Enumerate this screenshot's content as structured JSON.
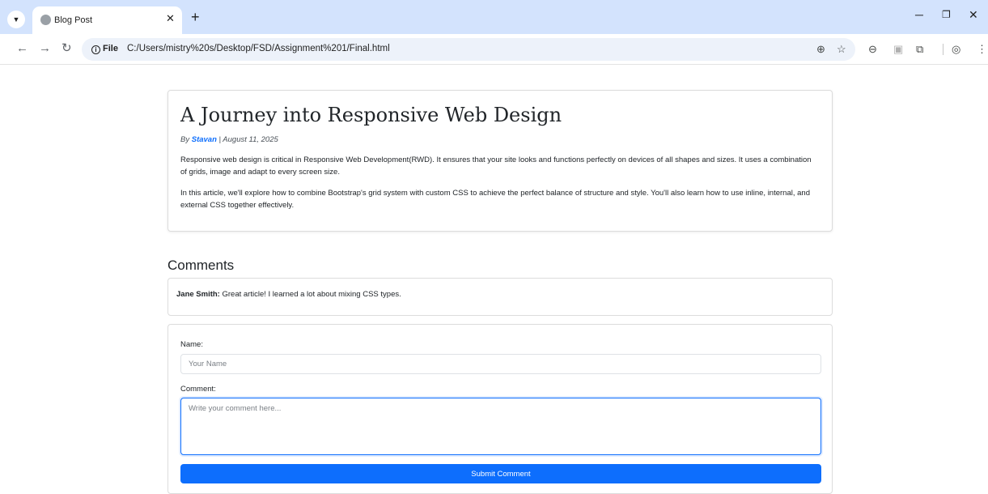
{
  "browser": {
    "tab_title": "Blog Post",
    "site_info_label": "File",
    "url": "C:/Users/mistry%20s/Desktop/FSD/Assignment%201/Final.html",
    "icons": {
      "tab_menu": "chevron-down-icon",
      "tab_close": "close-icon",
      "new_tab": "plus-icon",
      "back": "back-arrow-icon",
      "forward": "forward-arrow-icon",
      "reload": "reload-icon",
      "zoom": "zoom-icon",
      "bookmark": "star-icon",
      "extension_a": "extension-icon",
      "extension_b": "extension-icon",
      "extensions_menu": "puzzle-icon",
      "profile": "profile-icon",
      "more": "more-vertical-icon"
    }
  },
  "post": {
    "title": "A Journey into Responsive Web Design",
    "by_prefix": "By",
    "author": "Stavan",
    "date_sep": " | August 11, 2025",
    "paragraph_1": "Responsive web design is critical in Responsive Web Development(RWD). It ensures that your site looks and functions perfectly on devices of all shapes and sizes. It uses a combination of grids, image and adapt to every screen size.",
    "paragraph_2": "In this article, we'll explore how to combine Bootstrap's grid system with custom CSS to achieve the perfect balance of structure and style. You'll also learn how to use inline, internal, and external CSS together effectively."
  },
  "comments": {
    "heading": "Comments",
    "items": [
      {
        "author": "Jane Smith:",
        "text": " Great article! I learned a lot about mixing CSS types."
      }
    ]
  },
  "form": {
    "name_label": "Name:",
    "name_placeholder": "Your Name",
    "comment_label": "Comment:",
    "comment_placeholder": "Write your comment here...",
    "submit_label": "Submit Comment"
  },
  "colors": {
    "accent": "#0d6efd",
    "tabstrip": "#d3e3fd",
    "omnibox": "#edf2fa"
  }
}
